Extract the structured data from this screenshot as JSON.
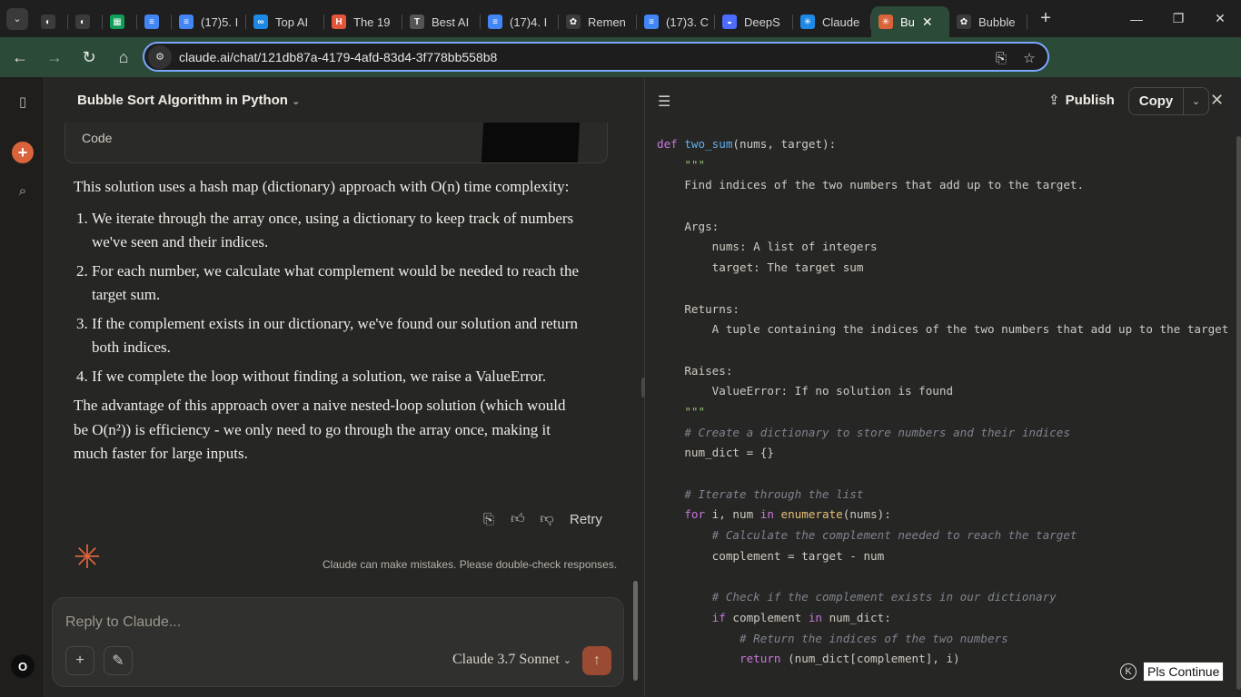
{
  "browser": {
    "tabs": [
      {
        "label": "",
        "icon": "globe-icon",
        "color": "#3b3b3b"
      },
      {
        "label": "",
        "icon": "globe-icon",
        "color": "#3b3b3b"
      },
      {
        "label": "",
        "icon": "sheets-icon",
        "color": "#0f9d58"
      },
      {
        "label": "",
        "icon": "docs-icon",
        "color": "#4285f4"
      },
      {
        "label": "(17)5. I",
        "icon": "docs-icon",
        "color": "#4285f4"
      },
      {
        "label": "Top AI",
        "icon": "swirl-icon",
        "color": "#1e88e5"
      },
      {
        "label": "The 19",
        "icon": "h-icon",
        "color": "#e2553b"
      },
      {
        "label": "Best AI",
        "icon": "t-icon",
        "color": "#555555"
      },
      {
        "label": "(17)4. I",
        "icon": "docs-icon",
        "color": "#4285f4"
      },
      {
        "label": "Remen",
        "icon": "openai-icon",
        "color": "#3b3b3b"
      },
      {
        "label": "(17)3. C",
        "icon": "docs-icon",
        "color": "#4285f4"
      },
      {
        "label": "DeepS",
        "icon": "deepseek-icon",
        "color": "#4d6bfe"
      },
      {
        "label": "Claude",
        "icon": "claude-icon",
        "color": "#1e88e5"
      },
      {
        "label": "Bu",
        "icon": "claude-icon",
        "color": "#d9643c",
        "active": true
      },
      {
        "label": "Bubble",
        "icon": "openai-icon",
        "color": "#3b3b3b"
      }
    ],
    "url": "claude.ai/chat/121db87a-4179-4afd-83d4-3f778bb558b8"
  },
  "chat": {
    "title": "Bubble Sort Algorithm in Python",
    "code_card_label": "Code",
    "intro": "This solution uses a hash map (dictionary) approach with O(n) time complexity:",
    "steps": [
      "We iterate through the array once, using a dictionary to keep track of numbers we've seen and their indices.",
      "For each number, we calculate what complement would be needed to reach the target sum.",
      "If the complement exists in our dictionary, we've found our solution and return both indices.",
      "If we complete the loop without finding a solution, we raise a ValueError."
    ],
    "outro": "The advantage of this approach over a naive nested-loop solution (which would be O(n²)) is efficiency - we only need to go through the array once, making it much faster for large inputs.",
    "retry_label": "Retry",
    "disclaimer": "Claude can make mistakes. Please double-check responses.",
    "composer_placeholder": "Reply to Claude...",
    "model_label": "Claude 3.7 Sonnet",
    "user_initial": "O"
  },
  "artifact": {
    "publish_label": "Publish",
    "copy_label": "Copy",
    "pls_continue": "Pls Continue",
    "code_lines": [
      [
        [
          "kw",
          "def "
        ],
        [
          "fn",
          "two_sum"
        ],
        [
          "",
          "(nums, target):"
        ]
      ],
      [
        [
          "st",
          "    \"\"\""
        ]
      ],
      [
        [
          "",
          "    Find indices of the two numbers that add up to the target."
        ]
      ],
      [
        [
          "",
          ""
        ]
      ],
      [
        [
          "",
          "    Args:"
        ]
      ],
      [
        [
          "",
          "        nums: A list of integers"
        ]
      ],
      [
        [
          "",
          "        target: The target sum"
        ]
      ],
      [
        [
          "",
          ""
        ]
      ],
      [
        [
          "",
          "    Returns:"
        ]
      ],
      [
        [
          "",
          "        A tuple containing the indices of the two numbers that add up to the target"
        ]
      ],
      [
        [
          "",
          ""
        ]
      ],
      [
        [
          "",
          "    Raises:"
        ]
      ],
      [
        [
          "",
          "        ValueError: If no solution is found"
        ]
      ],
      [
        [
          "st",
          "    \"\"\""
        ]
      ],
      [
        [
          "cm",
          "    # Create a dictionary to store numbers and their indices"
        ]
      ],
      [
        [
          "",
          "    num_dict = {}"
        ]
      ],
      [
        [
          "",
          ""
        ]
      ],
      [
        [
          "cm",
          "    # Iterate through the list"
        ]
      ],
      [
        [
          "kw",
          "    for "
        ],
        [
          "",
          "i, num "
        ],
        [
          "kw",
          "in "
        ],
        [
          "bi",
          "enumerate"
        ],
        [
          "",
          "(nums):"
        ]
      ],
      [
        [
          "cm",
          "        # Calculate the complement needed to reach the target"
        ]
      ],
      [
        [
          "",
          "        complement = target - num"
        ]
      ],
      [
        [
          "",
          ""
        ]
      ],
      [
        [
          "cm",
          "        # Check if the complement exists in our dictionary"
        ]
      ],
      [
        [
          "kw",
          "        if "
        ],
        [
          "",
          "complement "
        ],
        [
          "kw",
          "in "
        ],
        [
          "",
          "num_dict:"
        ]
      ],
      [
        [
          "cm",
          "            # Return the indices of the two numbers"
        ]
      ],
      [
        [
          "kw",
          "            return "
        ],
        [
          "",
          "(num_dict[complement], i)"
        ]
      ]
    ]
  }
}
